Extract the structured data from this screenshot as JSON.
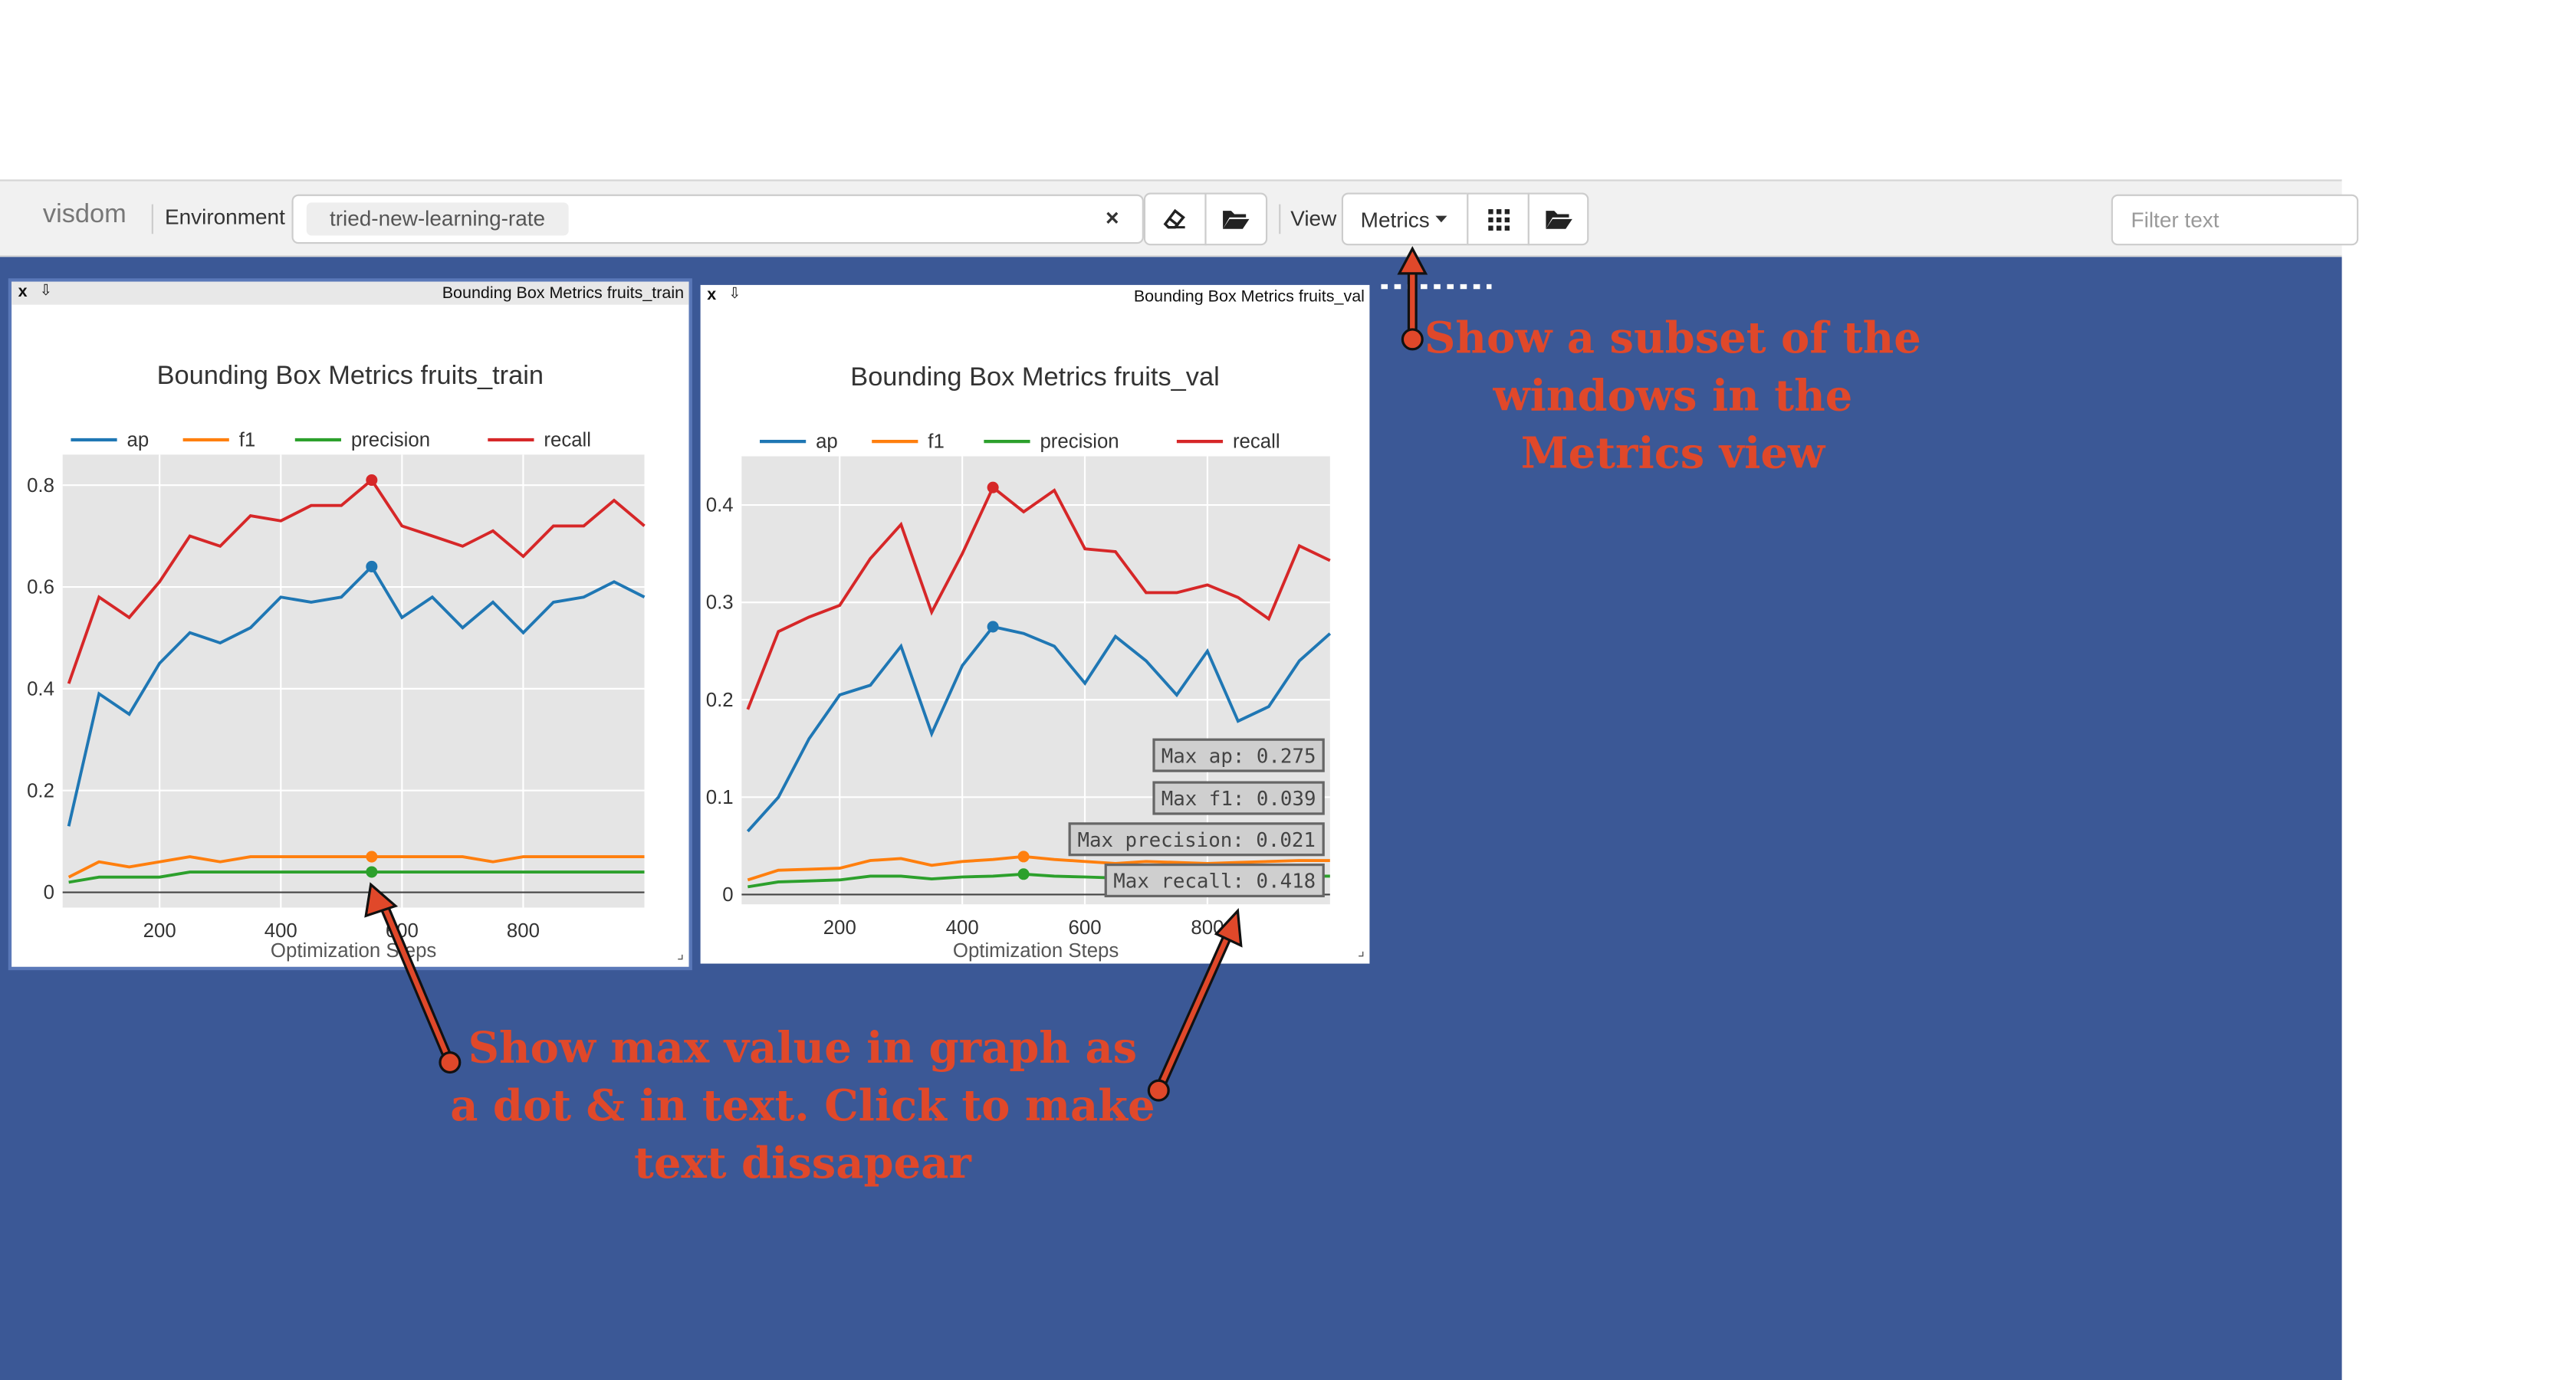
{
  "app": {
    "brand": "visdom"
  },
  "toolbar": {
    "env_label": "Environment",
    "env_value": "tried-new-learning-rate",
    "env_clear": "×",
    "view_label": "View",
    "view_selected": "Metrics",
    "filter_placeholder": "Filter text"
  },
  "panes": [
    {
      "title": "Bounding Box Metrics fruits_train",
      "close": "x",
      "download": "⇩"
    },
    {
      "title": "Bounding Box Metrics fruits_val",
      "close": "x",
      "download": "⇩"
    }
  ],
  "chart_data": [
    {
      "type": "line",
      "title": "Bounding Box Metrics fruits_train",
      "xlabel": "Optimization Steps",
      "ylabel": "",
      "xlim": [
        40,
        1000
      ],
      "ylim": [
        -0.03,
        0.86
      ],
      "xticks": [
        200,
        400,
        600,
        800
      ],
      "yticks": [
        0,
        0.2,
        0.4,
        0.6,
        0.8
      ],
      "ytick_labels": [
        "0",
        "0.2",
        "0.4",
        "0.6",
        "0.8"
      ],
      "grid": true,
      "legend": "top-left",
      "x": [
        50,
        100,
        150,
        200,
        250,
        300,
        350,
        400,
        450,
        500,
        550,
        600,
        650,
        700,
        750,
        800,
        850,
        900,
        950,
        1000
      ],
      "series": [
        {
          "name": "ap",
          "color": "#1f77b4",
          "values": [
            0.13,
            0.39,
            0.35,
            0.45,
            0.51,
            0.49,
            0.52,
            0.58,
            0.57,
            0.58,
            0.64,
            0.54,
            0.58,
            0.52,
            0.57,
            0.51,
            0.57,
            0.58,
            0.61,
            0.58
          ],
          "max_index": 10
        },
        {
          "name": "f1",
          "color": "#ff7f0e",
          "values": [
            0.03,
            0.06,
            0.05,
            0.06,
            0.07,
            0.06,
            0.07,
            0.07,
            0.07,
            0.07,
            0.07,
            0.07,
            0.07,
            0.07,
            0.06,
            0.07,
            0.07,
            0.07,
            0.07,
            0.07
          ],
          "max_index": 10
        },
        {
          "name": "precision",
          "color": "#2ca02c",
          "values": [
            0.02,
            0.03,
            0.03,
            0.03,
            0.04,
            0.04,
            0.04,
            0.04,
            0.04,
            0.04,
            0.04,
            0.04,
            0.04,
            0.04,
            0.04,
            0.04,
            0.04,
            0.04,
            0.04,
            0.04
          ],
          "max_index": 10
        },
        {
          "name": "recall",
          "color": "#d62728",
          "values": [
            0.41,
            0.58,
            0.54,
            0.61,
            0.7,
            0.68,
            0.74,
            0.73,
            0.76,
            0.76,
            0.81,
            0.72,
            0.7,
            0.68,
            0.71,
            0.66,
            0.72,
            0.72,
            0.77,
            0.72
          ],
          "max_index": 10
        }
      ],
      "zero_line": true
    },
    {
      "type": "line",
      "title": "Bounding Box Metrics fruits_val",
      "xlabel": "Optimization Steps",
      "ylabel": "",
      "xlim": [
        40,
        1000
      ],
      "ylim": [
        -0.01,
        0.45
      ],
      "xticks": [
        200,
        400,
        600,
        800
      ],
      "yticks": [
        0,
        0.1,
        0.2,
        0.3,
        0.4
      ],
      "ytick_labels": [
        "0",
        "0.1",
        "0.2",
        "0.3",
        "0.4"
      ],
      "grid": true,
      "legend": "top-left",
      "x": [
        50,
        100,
        150,
        200,
        250,
        300,
        350,
        400,
        450,
        500,
        550,
        600,
        650,
        700,
        750,
        800,
        850,
        900,
        950,
        1000
      ],
      "series": [
        {
          "name": "ap",
          "color": "#1f77b4",
          "values": [
            0.065,
            0.1,
            0.16,
            0.205,
            0.215,
            0.255,
            0.165,
            0.235,
            0.275,
            0.268,
            0.255,
            0.217,
            0.265,
            0.24,
            0.205,
            0.25,
            0.178,
            0.193,
            0.24,
            0.268
          ],
          "max_index": 8
        },
        {
          "name": "f1",
          "color": "#ff7f0e",
          "values": [
            0.015,
            0.025,
            0.026,
            0.027,
            0.035,
            0.037,
            0.03,
            0.034,
            0.036,
            0.039,
            0.036,
            0.034,
            0.032,
            0.034,
            0.033,
            0.032,
            0.033,
            0.034,
            0.035,
            0.035
          ],
          "max_index": 9
        },
        {
          "name": "precision",
          "color": "#2ca02c",
          "values": [
            0.008,
            0.013,
            0.014,
            0.015,
            0.019,
            0.019,
            0.016,
            0.018,
            0.019,
            0.021,
            0.019,
            0.018,
            0.017,
            0.018,
            0.018,
            0.017,
            0.018,
            0.018,
            0.019,
            0.019
          ],
          "max_index": 9
        },
        {
          "name": "recall",
          "color": "#d62728",
          "values": [
            0.19,
            0.27,
            0.285,
            0.297,
            0.345,
            0.38,
            0.29,
            0.35,
            0.418,
            0.393,
            0.415,
            0.355,
            0.352,
            0.31,
            0.31,
            0.318,
            0.305,
            0.283,
            0.358,
            0.343
          ],
          "max_index": 8
        }
      ],
      "zero_line": true,
      "annotations": [
        "Max ap: 0.275",
        "Max f1: 0.039",
        "Max precision: 0.021",
        "Max recall: 0.418"
      ]
    }
  ],
  "annotations": {
    "view_note": "Show a subset of the\nwindows in the\nMetrics view",
    "max_note": "Show max value in graph as\na dot & in text. Click to make\ntext dissapear"
  },
  "colors": {
    "workspace": "#3b5896",
    "annotation": "#e0482a"
  }
}
